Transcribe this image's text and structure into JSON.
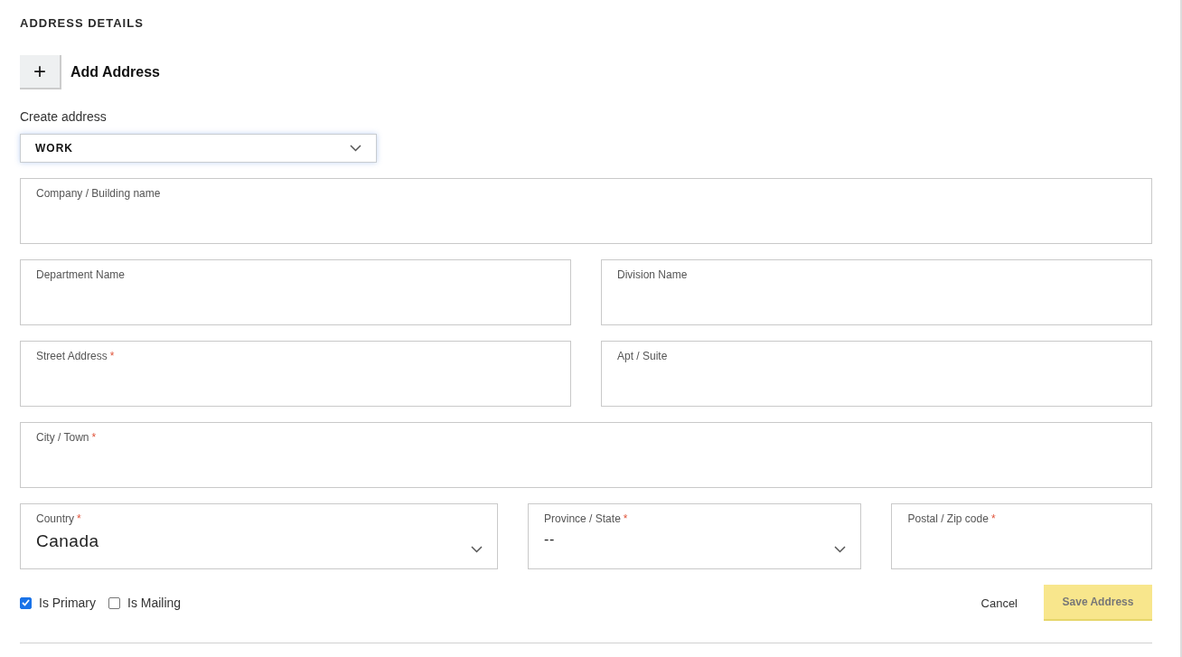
{
  "section_title": "ADDRESS DETAILS",
  "add_button": {
    "icon": "+",
    "label": "Add Address"
  },
  "address_type": {
    "label": "Create address",
    "value": "WORK"
  },
  "field_rows": [
    {
      "fields": [
        {
          "kind": "text",
          "label": "Company / Building name"
        }
      ]
    },
    {
      "fields": [
        {
          "kind": "text",
          "label": "Department Name"
        },
        {
          "kind": "text",
          "label": "Division Name"
        }
      ]
    },
    {
      "fields": [
        {
          "kind": "text",
          "label": "Street Address",
          "required_mark": "*"
        },
        {
          "kind": "text",
          "label": "Apt / Suite"
        }
      ]
    },
    {
      "fields": [
        {
          "kind": "text",
          "label": "City / Town",
          "required_mark": "*"
        }
      ]
    },
    {
      "fields": [
        {
          "kind": "select",
          "label": "Country",
          "required_mark": "*",
          "value": "Canada"
        },
        {
          "kind": "select",
          "label": "Province / State",
          "required_mark": "*",
          "value": "--"
        },
        {
          "kind": "text",
          "label": "Postal / Zip code",
          "required_mark": "*"
        }
      ]
    }
  ],
  "checkboxes": [
    {
      "label": "Is Primary",
      "checked": true
    },
    {
      "label": "Is Mailing",
      "checked": false
    }
  ],
  "cancel": "Cancel",
  "save": {
    "label": "Save Address",
    "disabled": true
  }
}
